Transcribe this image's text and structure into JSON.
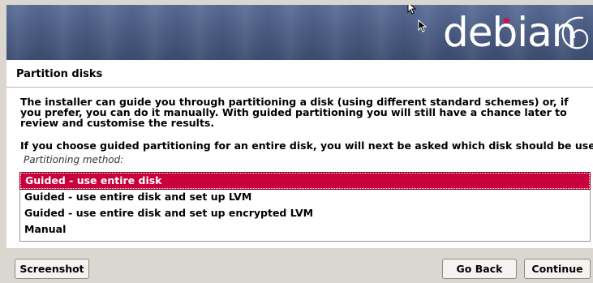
{
  "banner": {
    "logo_text": "debian",
    "brand_color": "#d70a53"
  },
  "step": {
    "title": "Partition disks"
  },
  "main": {
    "description": "The installer can guide you through partitioning a disk (using different standard schemes) or, if you prefer, you can do it manually. With guided partitioning you will still have a chance later to review and customise the results.",
    "description2": "If you choose guided partitioning for an entire disk, you will next be asked which disk should be used.",
    "method_label": "Partitioning method:",
    "options": [
      {
        "label": "Guided - use entire disk",
        "selected": true
      },
      {
        "label": "Guided - use entire disk and set up LVM",
        "selected": false
      },
      {
        "label": "Guided - use entire disk and set up encrypted LVM",
        "selected": false
      },
      {
        "label": "Manual",
        "selected": false
      }
    ],
    "selection_color": "#c8003c"
  },
  "footer": {
    "screenshot_label": "Screenshot",
    "goback_label": "Go Back",
    "continue_label": "Continue"
  },
  "icons": [
    "mouse-pointer-icon",
    "debian-swirl-icon"
  ]
}
